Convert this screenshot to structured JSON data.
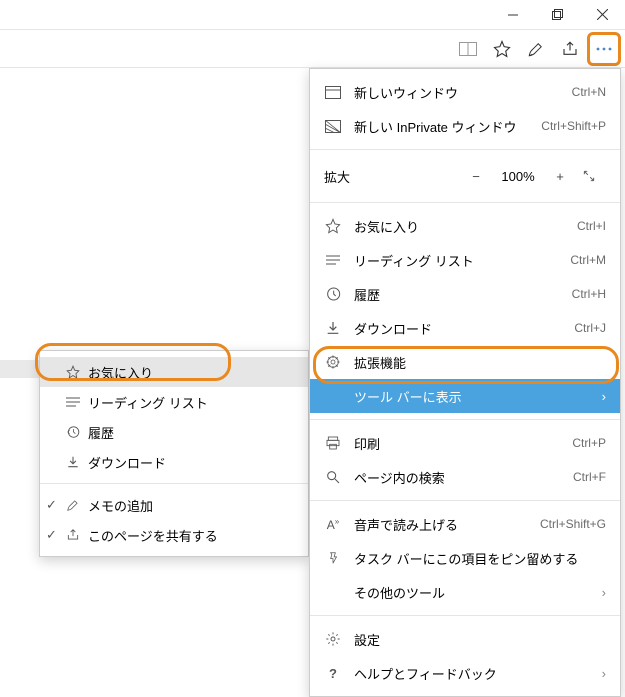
{
  "titlebar": {
    "min": "—",
    "max": "❐",
    "close": "✕"
  },
  "toolbar": {
    "readmode": "reading-mode-icon",
    "favorite": "star-icon",
    "notes": "pen-icon",
    "share": "share-icon",
    "more": "more-icon"
  },
  "menu": {
    "newWindow": {
      "label": "新しいウィンドウ",
      "shortcut": "Ctrl+N"
    },
    "newPrivate": {
      "label": "新しい InPrivate ウィンドウ",
      "shortcut": "Ctrl+Shift+P"
    },
    "zoom": {
      "label": "拡大",
      "value": "100%"
    },
    "favorites": {
      "label": "お気に入り",
      "shortcut": "Ctrl+I"
    },
    "readingList": {
      "label": "リーディング リスト",
      "shortcut": "Ctrl+M"
    },
    "history": {
      "label": "履歴",
      "shortcut": "Ctrl+H"
    },
    "downloads": {
      "label": "ダウンロード",
      "shortcut": "Ctrl+J"
    },
    "extensions": {
      "label": "拡張機能"
    },
    "showInToolbar": {
      "label": "ツール バーに表示"
    },
    "print": {
      "label": "印刷",
      "shortcut": "Ctrl+P"
    },
    "find": {
      "label": "ページ内の検索",
      "shortcut": "Ctrl+F"
    },
    "readAloud": {
      "label": "音声で読み上げる",
      "shortcut": "Ctrl+Shift+G"
    },
    "pinToTaskbar": {
      "label": "タスク バーにこの項目をピン留めする"
    },
    "moreTools": {
      "label": "その他のツール"
    },
    "settings": {
      "label": "設定"
    },
    "help": {
      "label": "ヘルプとフィードバック"
    }
  },
  "submenu": {
    "favorites": {
      "label": "お気に入り",
      "checked": false
    },
    "readingList": {
      "label": "リーディング リスト",
      "checked": false
    },
    "history": {
      "label": "履歴",
      "checked": false
    },
    "downloads": {
      "label": "ダウンロード",
      "checked": false
    },
    "addNotes": {
      "label": "メモの追加",
      "checked": true
    },
    "sharePage": {
      "label": "このページを共有する",
      "checked": true
    }
  }
}
